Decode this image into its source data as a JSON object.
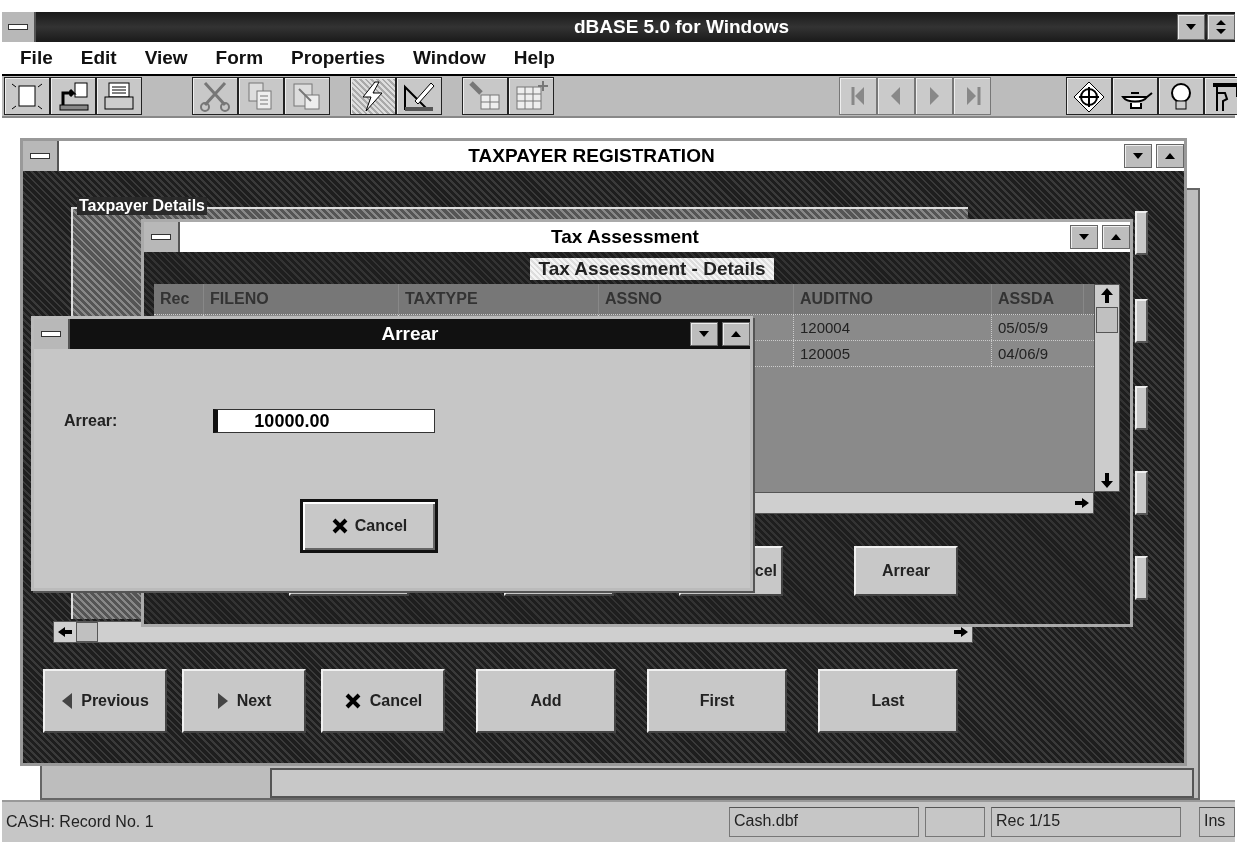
{
  "app": {
    "title": "dBASE 5.0 for Windows"
  },
  "menu": [
    {
      "label": "File"
    },
    {
      "label": "Edit"
    },
    {
      "label": "View"
    },
    {
      "label": "Form"
    },
    {
      "label": "Properties"
    },
    {
      "label": "Window"
    },
    {
      "label": "Help"
    }
  ],
  "toolbar": {
    "run_pressed": true,
    "navigation_disabled": true
  },
  "taxpayer_window": {
    "title": "TAXPAYER REGISTRATION",
    "group_label": "Taxpayer Details",
    "nav_buttons": [
      {
        "label": "Previous",
        "kind": "previous"
      },
      {
        "label": "Next",
        "kind": "next"
      },
      {
        "label": "Cancel",
        "kind": "cancel"
      },
      {
        "label": "Add",
        "kind": "plain"
      },
      {
        "label": "First",
        "kind": "plain"
      },
      {
        "label": "Last",
        "kind": "plain"
      }
    ]
  },
  "tax_window": {
    "title": "Tax Assessment",
    "subtitle": "Tax Assessment - Details",
    "columns": [
      "Rec",
      "FILENO",
      "TAXTYPE",
      "ASSNO",
      "AUDITNO",
      "ASSDA"
    ],
    "rows": [
      {
        "auditno": "120004",
        "assda": "05/05/9"
      },
      {
        "auditno": "120005",
        "assda": "04/06/9"
      }
    ],
    "buttons": [
      {
        "label": "cel"
      },
      {
        "label": "Arrear"
      }
    ]
  },
  "arrear_dialog": {
    "title": "Arrear",
    "label": "Arrear:",
    "value": "10000.00",
    "button": "Cancel"
  },
  "status_bar": {
    "message": "CASH: Record No. 1",
    "file": "Cash.dbf",
    "record": "Rec 1/15",
    "mode": "Ins"
  }
}
